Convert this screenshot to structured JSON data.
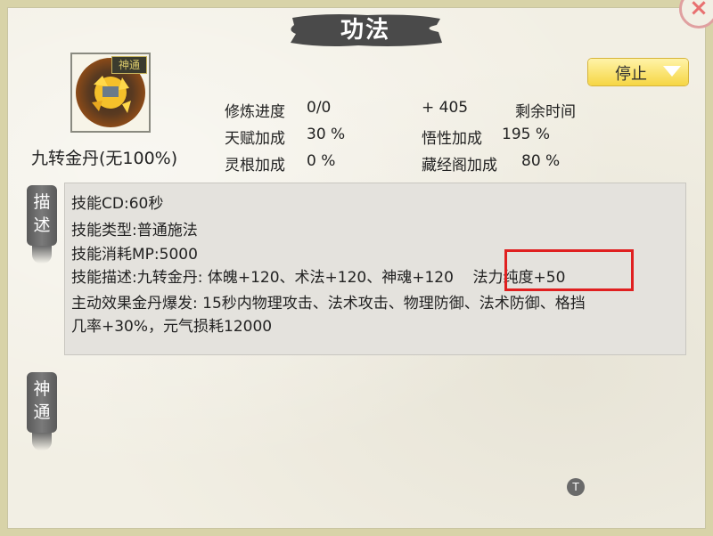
{
  "window": {
    "title": "功法",
    "close_label": "×"
  },
  "skill": {
    "icon_tag": "神通",
    "name": "九转金丹(无100%)"
  },
  "stop_button": {
    "label": "停止"
  },
  "stats": {
    "progress_label": "修炼进度",
    "progress_value": "0/0",
    "gain": "+ 405",
    "remaining_label": "剩余时间",
    "talent_label": "天赋加成",
    "talent_value": "30 %",
    "comprehension_label": "悟性加成",
    "comprehension_value": "195 %",
    "root_label": "灵根加成",
    "root_value": "0 %",
    "library_label": "藏经阁加成",
    "library_value": "80 %"
  },
  "tabs": {
    "describe": [
      "描",
      "述"
    ],
    "divine": [
      "神",
      "通"
    ]
  },
  "description": {
    "line1": "技能CD:60秒",
    "line2": "技能类型:普通施法",
    "line3": "技能消耗MP:5000",
    "line4": "技能描述:九转金丹: 体魄+120、术法+120、神魂+120    法力纯度+50",
    "line5": "主动效果金丹爆发: 15秒内物理攻击、法术攻击、物理防御、法术防御、格挡",
    "line6": "几率+30%，元气损耗12000"
  },
  "tip": {
    "label": "T"
  },
  "colors": {
    "highlight": "#e02020",
    "stop_button": "#f6d644",
    "panel_bg": "#f2efe4"
  }
}
